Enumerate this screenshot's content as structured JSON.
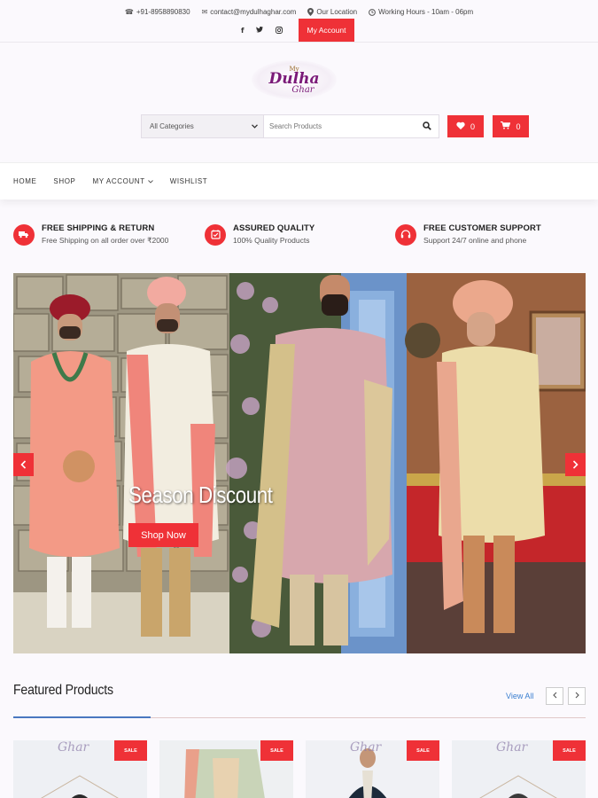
{
  "topbar": {
    "phone": "+91-8958890830",
    "email": "contact@mydulhaghar.com",
    "location": "Our Location",
    "hours": "Working Hours - 10am - 06pm",
    "social": [
      "f",
      "t",
      "o"
    ],
    "my_account": "My Account"
  },
  "header": {
    "logo_line1": "My",
    "logo_line2": "Dulha",
    "logo_line3": "Ghar",
    "category_select": "All Categories",
    "search_placeholder": "Search Products",
    "wishlist_count": "0",
    "cart_count": "0"
  },
  "nav": {
    "items": [
      "HOME",
      "SHOP",
      "MY ACCOUNT",
      "WISHLIST"
    ]
  },
  "features": [
    {
      "title": "FREE SHIPPING & RETURN",
      "subtitle": "Free Shipping on all order over ₹2000"
    },
    {
      "title": "ASSURED QUALITY",
      "subtitle": "100% Quality Products"
    },
    {
      "title": "FREE CUSTOMER SUPPORT",
      "subtitle": "Support 24/7 online and phone"
    }
  ],
  "banner": {
    "title": "Season Discount",
    "button": "Shop Now"
  },
  "featured": {
    "title": "Featured Products",
    "view_all": "View All",
    "sale_badge": "SALE",
    "brand_watermark": "Ghar"
  },
  "colors": {
    "accent": "#ef3137",
    "link": "#3a7fd0",
    "logo_purple": "#7a1a78"
  }
}
